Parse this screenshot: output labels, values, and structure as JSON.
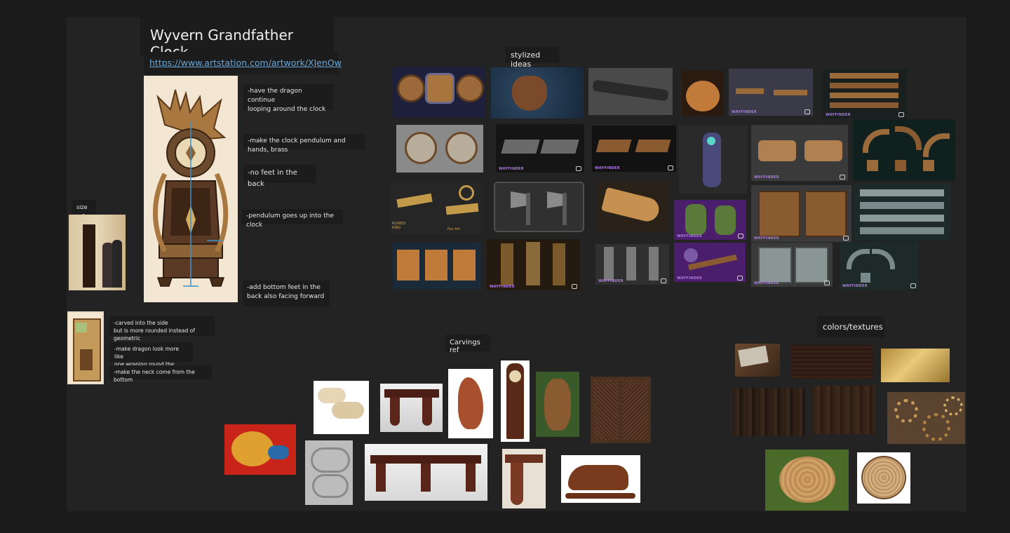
{
  "board": {
    "title": "Wyvern Grandfather Clock",
    "link": "https://www.artstation.com/artwork/XJenOw"
  },
  "notes": [
    "-have the dragon continue\n looping around the clock",
    "-make the clock pendulum and hands, brass",
    "-no feet in the back",
    "-pendulum goes up into the clock",
    "-add bottom feet in the\nback also facing forward",
    "-carved into the side\nbut is more rounded instead of geometric",
    "-make dragon look more like\n one wraping round the clock",
    "-make the neck come from the bottom"
  ],
  "sections": {
    "size_ref": "size ref",
    "stylized": "stylized ideas",
    "carvings": "Carvings ref",
    "colors": "colors/textures"
  },
  "watermarks": {
    "wayfinder": "WAYFINDER",
    "ruined_king": "RUINED\nKING",
    "fan_art": "Fan Art"
  },
  "icons": {
    "wayfinder_mark": "studio-logo-icon"
  },
  "colors": {
    "board_bg": "#232323",
    "page_bg": "#1b1b1b",
    "label_bg": "#1c1c1c",
    "link": "#6aa6d6",
    "wayfinder_purple": "#b07ae6"
  }
}
